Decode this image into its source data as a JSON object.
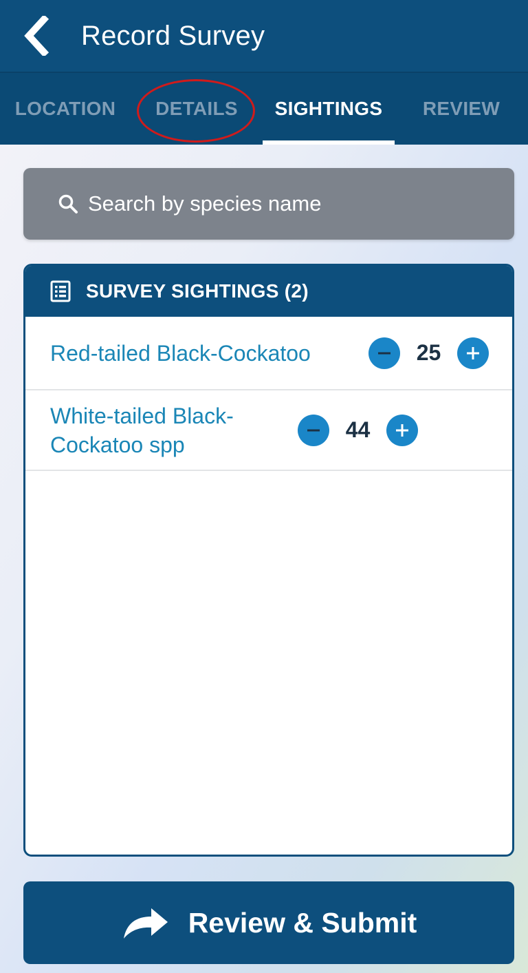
{
  "header": {
    "title": "Record Survey",
    "back_icon": "chevron-left-icon"
  },
  "tabs": [
    {
      "label": "LOCATION",
      "active": false
    },
    {
      "label": "DETAILS",
      "active": false
    },
    {
      "label": "SIGHTINGS",
      "active": true
    },
    {
      "label": "REVIEW",
      "active": false
    }
  ],
  "search": {
    "placeholder": "Search by species name",
    "icon": "search-icon"
  },
  "sightings": {
    "title": "SURVEY SIGHTINGS (2)",
    "icon": "list-icon",
    "items": [
      {
        "species": "Red-tailed Black-Cockatoo",
        "count": "25"
      },
      {
        "species": "White-tailed Black-Cockatoo spp",
        "count": "44"
      }
    ]
  },
  "submit": {
    "label": "Review & Submit",
    "icon": "share-arrow-icon"
  },
  "colors": {
    "primary": "#0d4f7d",
    "accent": "#1a86c8",
    "annotation": "#d01b1b"
  }
}
